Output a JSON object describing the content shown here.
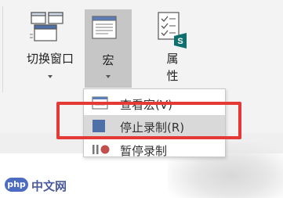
{
  "ribbon": {
    "switch_window": {
      "label": "切换窗口",
      "icon": "switch-windows-icon"
    },
    "macro": {
      "label": "宏",
      "icon": "macro-icon",
      "selected": true
    },
    "properties": {
      "label": "属\n性",
      "icon": "properties-icon",
      "badge": "S"
    }
  },
  "macro_menu": {
    "items": [
      {
        "label": "查看宏(V)",
        "icon": "view-macros-icon"
      },
      {
        "label": "停止录制(R)",
        "icon": "stop-recording-icon",
        "highlighted": true
      },
      {
        "label": "暂停录制",
        "icon": "pause-recording-icon"
      }
    ]
  },
  "watermark": {
    "badge": "php",
    "text": "中文网"
  },
  "colors": {
    "highlight_box": "#e53935",
    "ribbon_bg": "#f3f3f3",
    "selected_bg": "#c6c6c6",
    "menu_hover_bg": "#d9d9d9",
    "stop_icon": "#4f6fa8",
    "sharepoint": "#0f6f6f",
    "record_dot": "#c0504d"
  }
}
